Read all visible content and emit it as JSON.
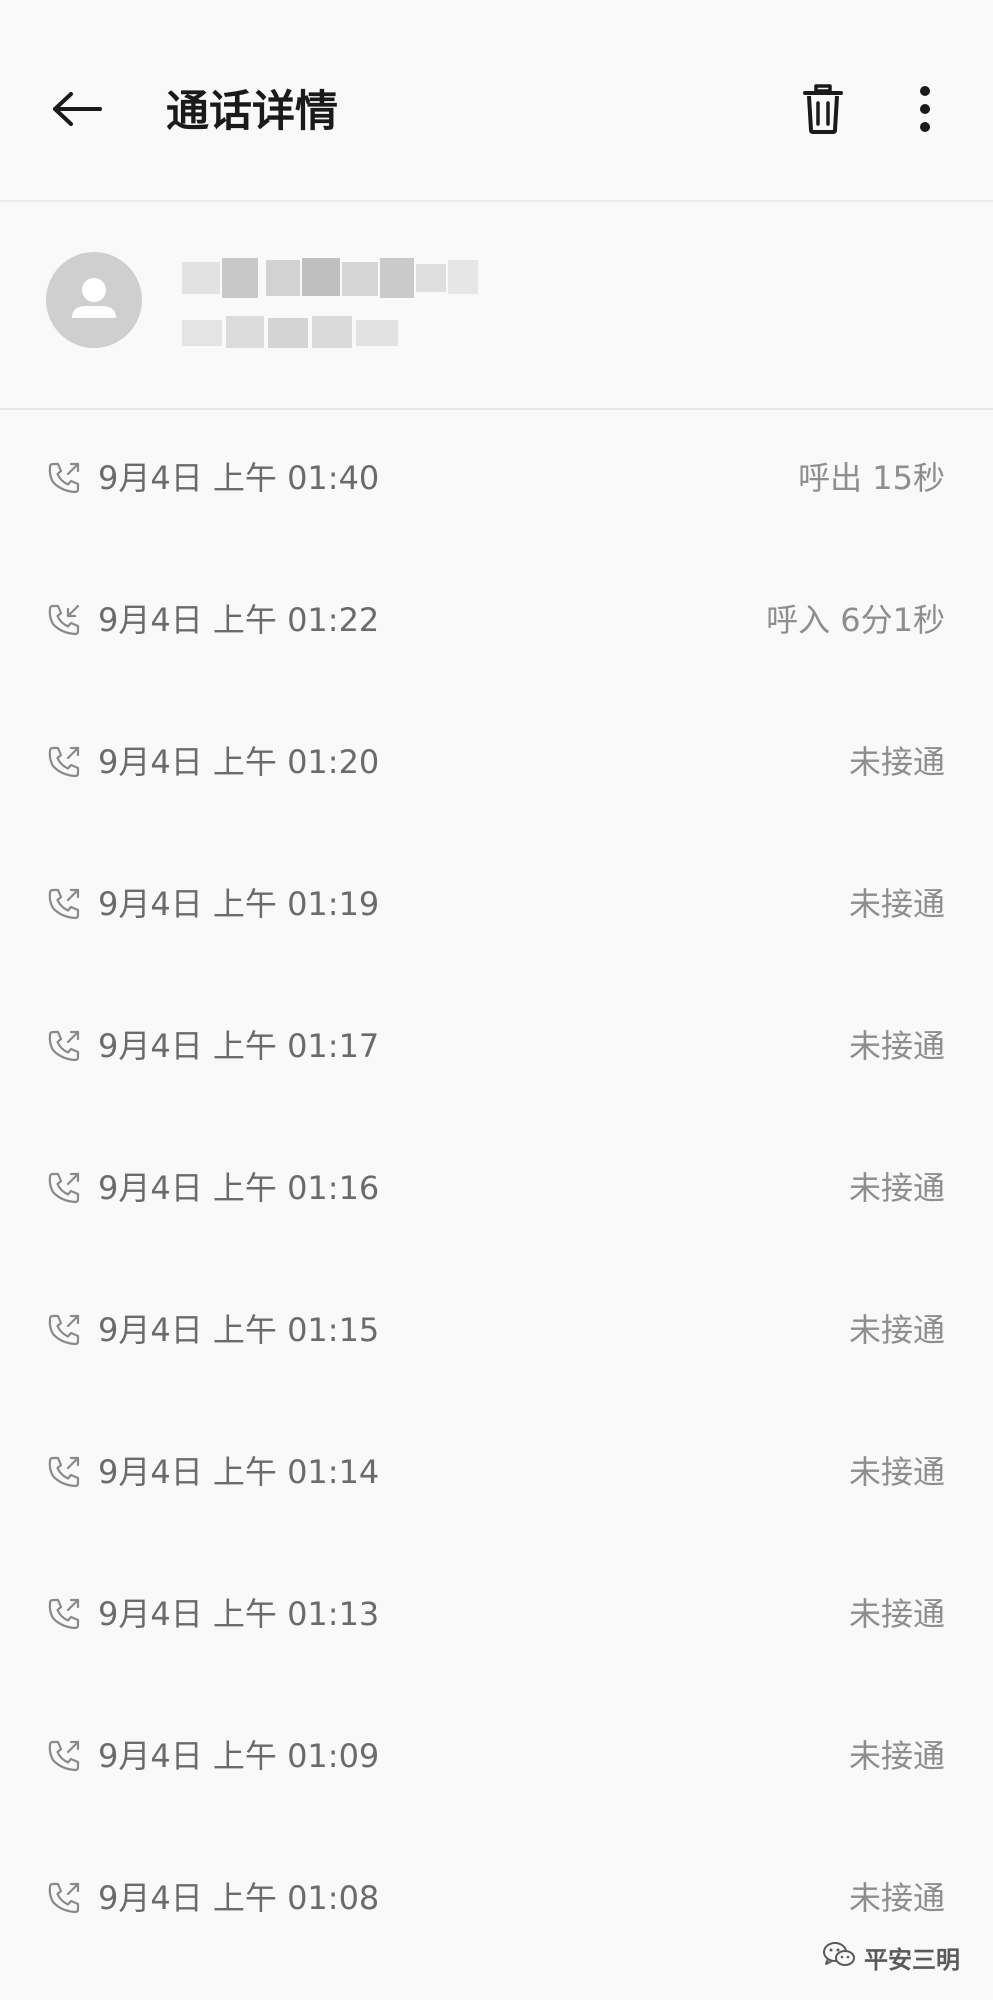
{
  "header": {
    "title": "通话详情",
    "back_icon": "back-arrow-icon",
    "delete_icon": "trash-icon",
    "more_icon": "more-vertical-icon"
  },
  "contact": {
    "avatar_icon": "person-icon",
    "name_obscured": true
  },
  "calls": [
    {
      "type": "outgoing",
      "icon": "outgoing-call-icon",
      "time": "9月4日 上午 01:40",
      "status": "呼出 15秒"
    },
    {
      "type": "incoming",
      "icon": "incoming-call-icon",
      "time": "9月4日 上午 01:22",
      "status": "呼入 6分1秒"
    },
    {
      "type": "outgoing",
      "icon": "outgoing-call-icon",
      "time": "9月4日 上午 01:20",
      "status": "未接通"
    },
    {
      "type": "outgoing",
      "icon": "outgoing-call-icon",
      "time": "9月4日 上午 01:19",
      "status": "未接通"
    },
    {
      "type": "outgoing",
      "icon": "outgoing-call-icon",
      "time": "9月4日 上午 01:17",
      "status": "未接通"
    },
    {
      "type": "outgoing",
      "icon": "outgoing-call-icon",
      "time": "9月4日 上午 01:16",
      "status": "未接通"
    },
    {
      "type": "outgoing",
      "icon": "outgoing-call-icon",
      "time": "9月4日 上午 01:15",
      "status": "未接通"
    },
    {
      "type": "outgoing",
      "icon": "outgoing-call-icon",
      "time": "9月4日 上午 01:14",
      "status": "未接通"
    },
    {
      "type": "outgoing",
      "icon": "outgoing-call-icon",
      "time": "9月4日 上午 01:13",
      "status": "未接通"
    },
    {
      "type": "outgoing",
      "icon": "outgoing-call-icon",
      "time": "9月4日 上午 01:09",
      "status": "未接通"
    },
    {
      "type": "outgoing",
      "icon": "outgoing-call-icon",
      "time": "9月4日 上午 01:08",
      "status": "未接通"
    }
  ],
  "watermark": {
    "text": "平安三明",
    "icon": "wechat-icon"
  },
  "colors": {
    "background": "#f9f9f9",
    "title": "#1a1a1a",
    "time_text": "#6b6b6b",
    "status_text": "#8e8e8e",
    "avatar_bg": "#cfcfcf"
  }
}
